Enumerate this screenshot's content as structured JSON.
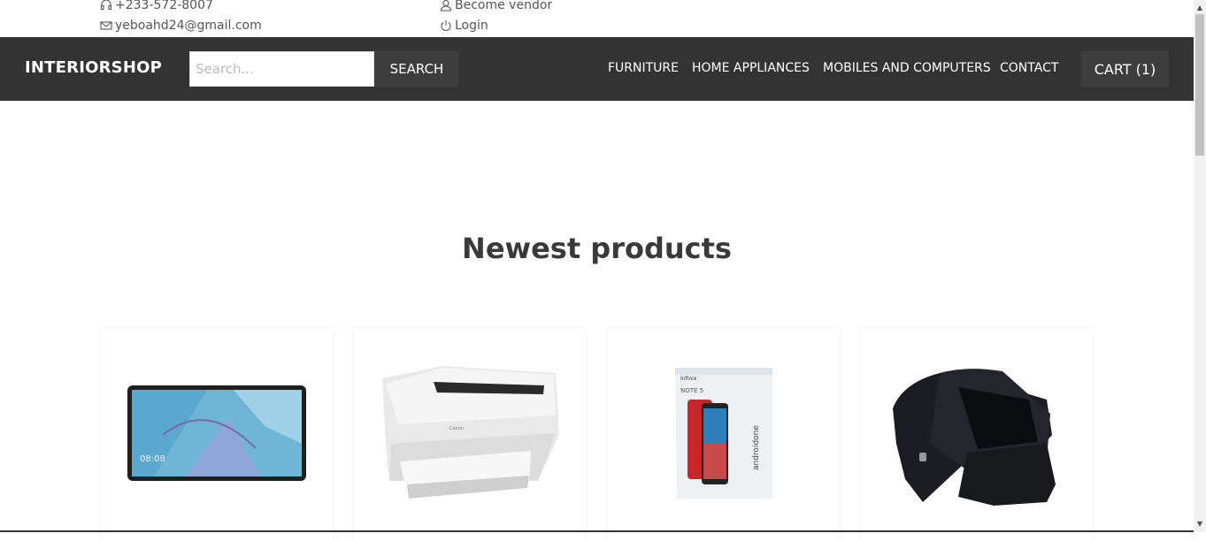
{
  "topbar": {
    "phone": "+233-572-8007",
    "email": "yeboahd24@gmail.com",
    "vendor": "Become vendor",
    "login": "Login"
  },
  "navbar": {
    "brand": "INTERIORSHOP",
    "search_placeholder": "Search...",
    "search_button": "SEARCH",
    "links": [
      "FURNITURE",
      "HOME APPLIANCES",
      "MOBILES AND COMPUTERS",
      "CONTACT"
    ],
    "cart": "CART (1)"
  },
  "main": {
    "title": "Newest products",
    "products": [
      {
        "image": "tablet"
      },
      {
        "image": "printer"
      },
      {
        "image": "smartphone-box"
      },
      {
        "image": "smartwatch"
      }
    ]
  },
  "colors": {
    "navbar_bg": "#333333",
    "button_bg": "#3d3d3d",
    "title_color": "#3a3a3a"
  }
}
